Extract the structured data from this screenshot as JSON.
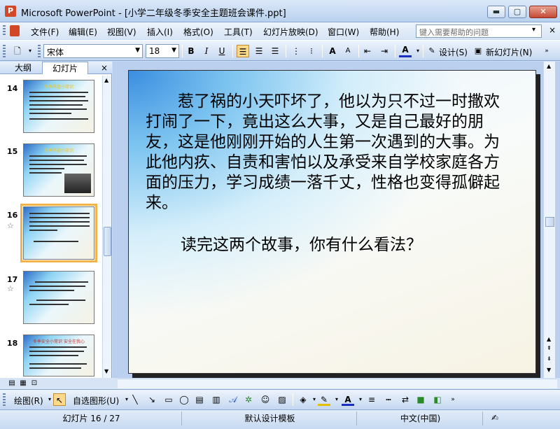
{
  "window": {
    "title": "Microsoft PowerPoint - [小学二年级冬季安全主题班会课件.ppt]",
    "app_icon_glyph": "P",
    "minimize_glyph": "▬",
    "maximize_glyph": "▢",
    "close_glyph": "✕"
  },
  "menu": {
    "items": [
      "文件(F)",
      "编辑(E)",
      "视图(V)",
      "插入(I)",
      "格式(O)",
      "工具(T)",
      "幻灯片放映(D)",
      "窗口(W)",
      "帮助(H)"
    ],
    "help_placeholder": "键入需要帮助的问题",
    "help_arrow": "▾",
    "close_glyph": "×"
  },
  "toolbar": {
    "font_name": "宋体",
    "font_size": "18",
    "bold": "B",
    "italic": "I",
    "underline": "U",
    "grow_font": "A",
    "shrink_font": "A",
    "font_color": "A",
    "design_label": "设计(S)",
    "new_slide_label": "新幻灯片(N)"
  },
  "left_pane": {
    "tab_outline": "大纲",
    "tab_slides": "幻灯片",
    "close_glyph": "×",
    "thumbnails": [
      {
        "number": "14",
        "title": "冬季防盗小常识",
        "star": ""
      },
      {
        "number": "15",
        "title": "冬季防盗小常识",
        "star": ""
      },
      {
        "number": "16",
        "title": "",
        "star": "☆"
      },
      {
        "number": "17",
        "title": "",
        "star": "☆"
      },
      {
        "number": "18",
        "title": "冬季安全小常识  安全在我心",
        "star": ""
      }
    ]
  },
  "slide": {
    "paragraph1": "　　惹了祸的小天吓坏了，他以为只不过一时撒欢打闹了一下，竟出这么大事，又是自己最好的朋友，这是他刚刚开始的人生第一次遇到的大事。为此他内疚、自责和害怕以及承受来自学校家庭各方面的压力，学习成绩一落千丈，性格也变得孤僻起来。",
    "paragraph2": "读完这两个故事，你有什么看法？"
  },
  "draw_toolbar": {
    "draw_label": "绘图(R)",
    "autoshape_label": "自选图形(U)"
  },
  "status": {
    "slide_indicator": "幻灯片 16 / 27",
    "template": "默认设计模板",
    "language": "中文(中国)"
  },
  "colors": {
    "accent": "#d24726",
    "selection": "#f2b348",
    "chrome": "#c9dcf5"
  }
}
